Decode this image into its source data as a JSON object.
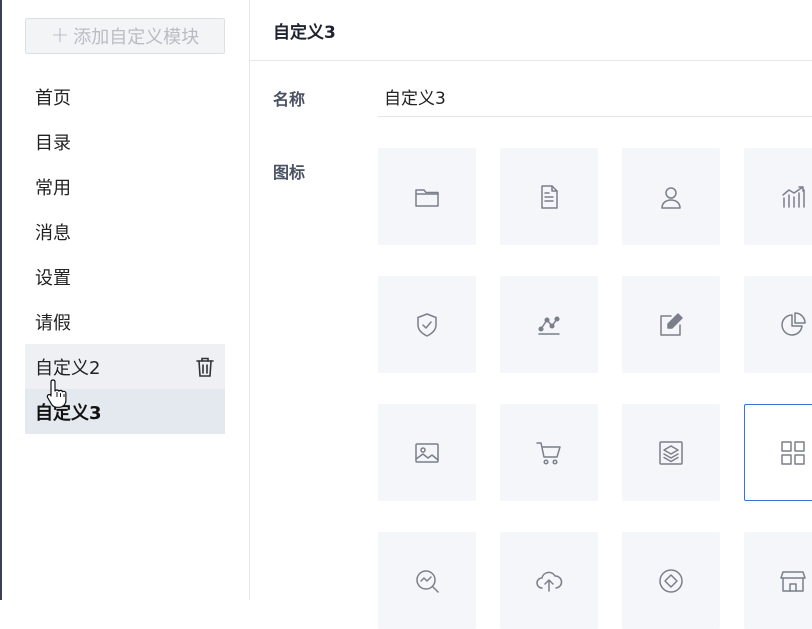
{
  "sidebar": {
    "add_button_label": "添加自定义模块",
    "items": [
      {
        "label": "首页"
      },
      {
        "label": "目录"
      },
      {
        "label": "常用"
      },
      {
        "label": "消息"
      },
      {
        "label": "设置"
      },
      {
        "label": "请假"
      },
      {
        "label": "自定义2"
      },
      {
        "label": "自定义3"
      }
    ]
  },
  "main": {
    "title": "自定义3",
    "name_label": "名称",
    "name_value": "自定义3",
    "icon_label": "图标",
    "icons": [
      "folder-icon",
      "document-icon",
      "user-icon",
      "bar-chart-icon",
      "shield-check-icon",
      "line-chart-icon",
      "edit-icon",
      "pie-chart-icon",
      "image-icon",
      "cart-icon",
      "layers-icon",
      "grid-icon",
      "search-chart-icon",
      "cloud-upload-icon",
      "compass-icon",
      "store-icon"
    ],
    "selected_icon": "grid-icon"
  },
  "colors": {
    "accent": "#3b6fd6",
    "tile_bg": "#f4f6fa"
  }
}
